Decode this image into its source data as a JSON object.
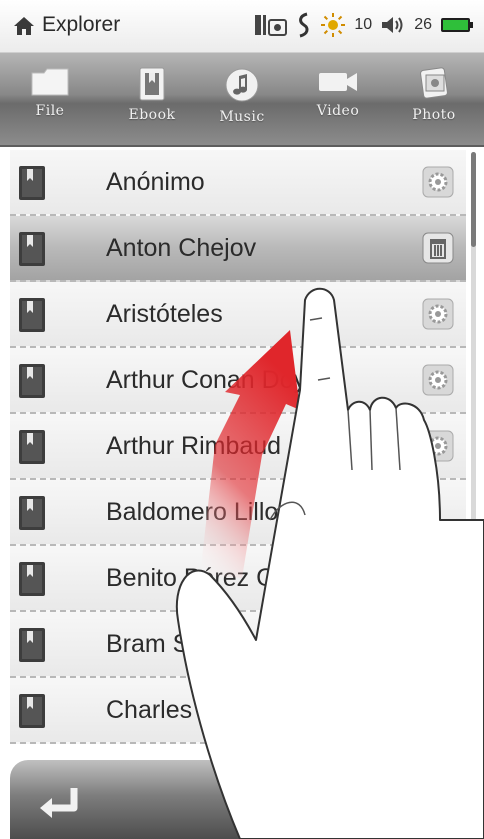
{
  "status": {
    "title": "Explorer",
    "brightness": "10",
    "volume": "26"
  },
  "toolbar": {
    "items": [
      {
        "label": "File",
        "icon": "folder-icon"
      },
      {
        "label": "Ebook",
        "icon": "ebook-icon"
      },
      {
        "label": "Music",
        "icon": "music-icon"
      },
      {
        "label": "Video",
        "icon": "video-icon"
      },
      {
        "label": "Photo",
        "icon": "photo-icon"
      }
    ]
  },
  "list": {
    "items": [
      {
        "label": "Anónimo",
        "action": "settings-icon"
      },
      {
        "label": "Anton Chejov",
        "action": "delete-icon",
        "selected": true
      },
      {
        "label": "Aristóteles",
        "action": "settings-icon"
      },
      {
        "label": "Arthur Conan Doyle",
        "action": "settings-icon"
      },
      {
        "label": "Arthur Rimbaud",
        "action": "settings-icon"
      },
      {
        "label": "Baldomero Lillo",
        "action": ""
      },
      {
        "label": "Benito Pérez Galdós",
        "action": ""
      },
      {
        "label": "Bram Stoker",
        "action": ""
      },
      {
        "label": "Charles Dickens",
        "action": ""
      }
    ]
  },
  "colors": {
    "accent_arrow": "#e0262b",
    "battery": "#2fbf3a"
  }
}
